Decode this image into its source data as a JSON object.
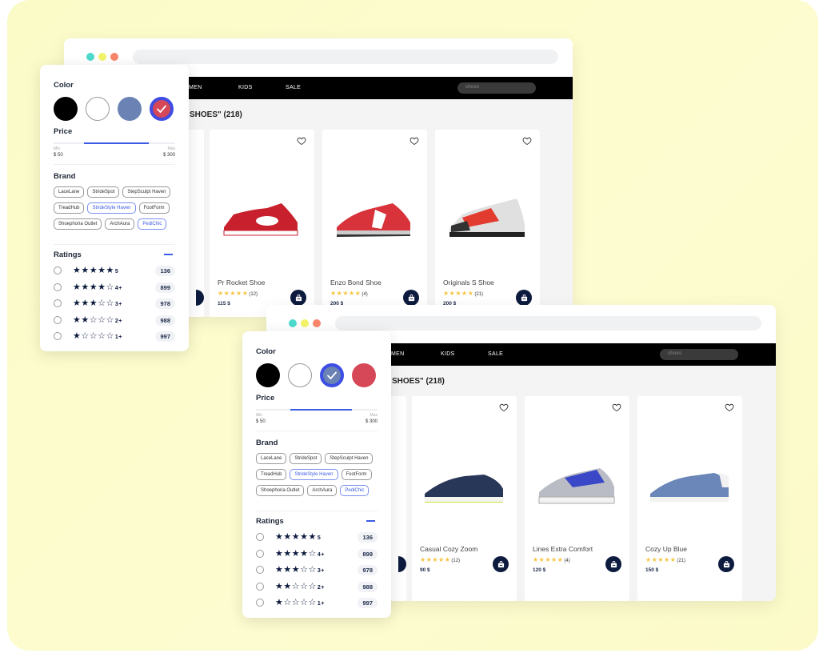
{
  "colors": {
    "background": "#fdfcd0",
    "accent": "#3b5be6",
    "cart": "#0d1b3e",
    "star": "#f5c542"
  },
  "windows": [
    {
      "nav": [
        "MEN",
        "KIDS",
        "SALE"
      ],
      "search_value": "shoes",
      "results_title": "SHOES\" (218)",
      "products": [
        {
          "name": "Pr Rocket Shoe",
          "stars": "★★★★★",
          "reviews": "(12)",
          "price": "115 $",
          "image": "red-white-sneaker"
        },
        {
          "name": "Enzo Bond Shoe",
          "stars": "★★★★★",
          "reviews": "(4)",
          "price": "200 $",
          "image": "red-running-shoe"
        },
        {
          "name": "Originals S Shoe",
          "stars": "★★★★★",
          "reviews": "(21)",
          "price": "200 $",
          "image": "red-grey-trail-shoe"
        }
      ],
      "filters": {
        "color_title": "Color",
        "colors": [
          {
            "name": "black",
            "selected": false
          },
          {
            "name": "white",
            "selected": false
          },
          {
            "name": "blue",
            "selected": false
          },
          {
            "name": "red",
            "selected": true
          }
        ],
        "price_title": "Price",
        "price_min_label": "Min",
        "price_max_label": "Max",
        "price_min": "$ 50",
        "price_max": "$ 300",
        "price_range_fraction": [
          0.25,
          0.78
        ],
        "brand_title": "Brand",
        "brands": [
          {
            "label": "LaceLane",
            "selected": false
          },
          {
            "label": "StrideSpot",
            "selected": false
          },
          {
            "label": "StepSculpt Haven",
            "selected": false
          },
          {
            "label": "TreadHub",
            "selected": false
          },
          {
            "label": "StrideStyle Haven",
            "selected": true
          },
          {
            "label": "FootForm",
            "selected": false
          },
          {
            "label": "Shoephoria Outlet",
            "selected": false
          },
          {
            "label": "ArchAura",
            "selected": false
          },
          {
            "label": "PediChic",
            "selected": true
          }
        ],
        "ratings_title": "Ratings",
        "ratings": [
          {
            "stars": "★★★★★",
            "label": "5",
            "count": "136"
          },
          {
            "stars": "★★★★☆",
            "label": "4+",
            "count": "899"
          },
          {
            "stars": "★★★☆☆",
            "label": "3+",
            "count": "978"
          },
          {
            "stars": "★★☆☆☆",
            "label": "2+",
            "count": "988"
          },
          {
            "stars": "★☆☆☆☆",
            "label": "1+",
            "count": "997"
          }
        ]
      }
    },
    {
      "nav": [
        "MEN",
        "KIDS",
        "SALE"
      ],
      "search_value": "shoes",
      "results_title": "SHOES\" (218)",
      "products": [
        {
          "name": "Casual Cozy Zoom",
          "stars": "★★★★★",
          "reviews": "(12)",
          "price": "90 $",
          "image": "navy-canvas-sneaker"
        },
        {
          "name": "Lines Extra Comfort",
          "stars": "★★★★★",
          "reviews": "(4)",
          "price": "120 $",
          "image": "silver-blue-runner"
        },
        {
          "name": "Cozy Up Blue",
          "stars": "★★★★★",
          "reviews": "(21)",
          "price": "150 $",
          "image": "light-blue-sneaker"
        }
      ],
      "filters": {
        "color_title": "Color",
        "colors": [
          {
            "name": "black",
            "selected": false
          },
          {
            "name": "white",
            "selected": false
          },
          {
            "name": "blue",
            "selected": true
          },
          {
            "name": "red",
            "selected": false
          }
        ],
        "price_title": "Price",
        "price_min_label": "Min",
        "price_max_label": "Max",
        "price_min": "$ 50",
        "price_max": "$ 300",
        "price_range_fraction": [
          0.28,
          0.79
        ],
        "brand_title": "Brand",
        "brands": [
          {
            "label": "LaceLane",
            "selected": false
          },
          {
            "label": "StrideSpot",
            "selected": false
          },
          {
            "label": "StepSculpt Haven",
            "selected": false
          },
          {
            "label": "TreadHub",
            "selected": false
          },
          {
            "label": "StrideStyle Haven",
            "selected": true
          },
          {
            "label": "FootForm",
            "selected": false
          },
          {
            "label": "Shoephoria Outlet",
            "selected": false
          },
          {
            "label": "ArchAura",
            "selected": false
          },
          {
            "label": "PediChic",
            "selected": true
          }
        ],
        "ratings_title": "Ratings",
        "ratings": [
          {
            "stars": "★★★★★",
            "label": "5",
            "count": "136"
          },
          {
            "stars": "★★★★☆",
            "label": "4+",
            "count": "899"
          },
          {
            "stars": "★★★☆☆",
            "label": "3+",
            "count": "978"
          },
          {
            "stars": "★★☆☆☆",
            "label": "2+",
            "count": "988"
          },
          {
            "stars": "★☆☆☆☆",
            "label": "1+",
            "count": "997"
          }
        ]
      }
    }
  ]
}
